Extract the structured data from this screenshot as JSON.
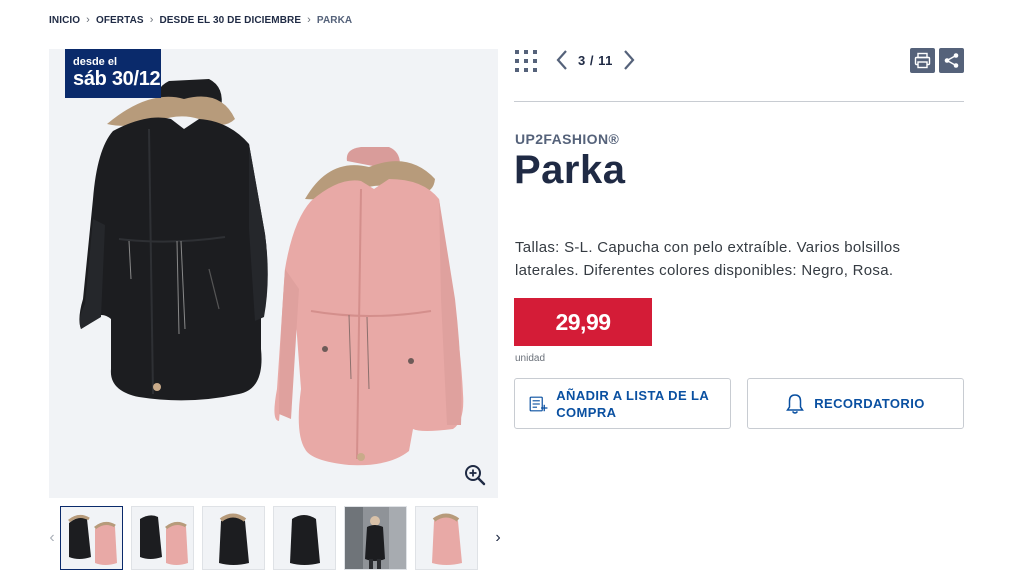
{
  "breadcrumb": {
    "items": [
      "INICIO",
      "OFERTAS",
      "DESDE EL 30 DE DICIEMBRE"
    ],
    "current": "PARKA",
    "separator": ">"
  },
  "badge": {
    "small": "desde el",
    "big": "sáb 30/12"
  },
  "gallery": {
    "main_image": "parka-black-and-pink",
    "zoom_icon": "zoom-in-icon",
    "thumbnails": [
      {
        "name": "thumb-black-pink",
        "active": true
      },
      {
        "name": "thumb-black-pink-alt",
        "active": false
      },
      {
        "name": "thumb-black-fur",
        "active": false
      },
      {
        "name": "thumb-black-back",
        "active": false
      },
      {
        "name": "thumb-model-photo",
        "active": false
      },
      {
        "name": "thumb-pink",
        "active": false
      }
    ]
  },
  "pager": {
    "label": "3 / 11"
  },
  "tools": {
    "print_icon": "print-icon",
    "share_icon": "share-icon"
  },
  "product": {
    "brand": "UP2FASHION®",
    "title": "Parka",
    "description": "Tallas: S-L. Capucha con pelo extraíble. Varios bolsillos laterales. Diferentes colores disponibles: Negro, Rosa.",
    "price": "29,99",
    "unit": "unidad"
  },
  "actions": {
    "shopping_list": "AÑADIR A LISTA DE LA COMPRA",
    "reminder": "RECORDATORIO"
  },
  "colors": {
    "navy": "#0a2a6b",
    "title": "#1f2a44",
    "price_red": "#d41c37",
    "link_blue": "#0a50a1",
    "coat_black": "#1c1d20",
    "coat_pink": "#e8a9a6",
    "fur": "#b79b7b"
  }
}
